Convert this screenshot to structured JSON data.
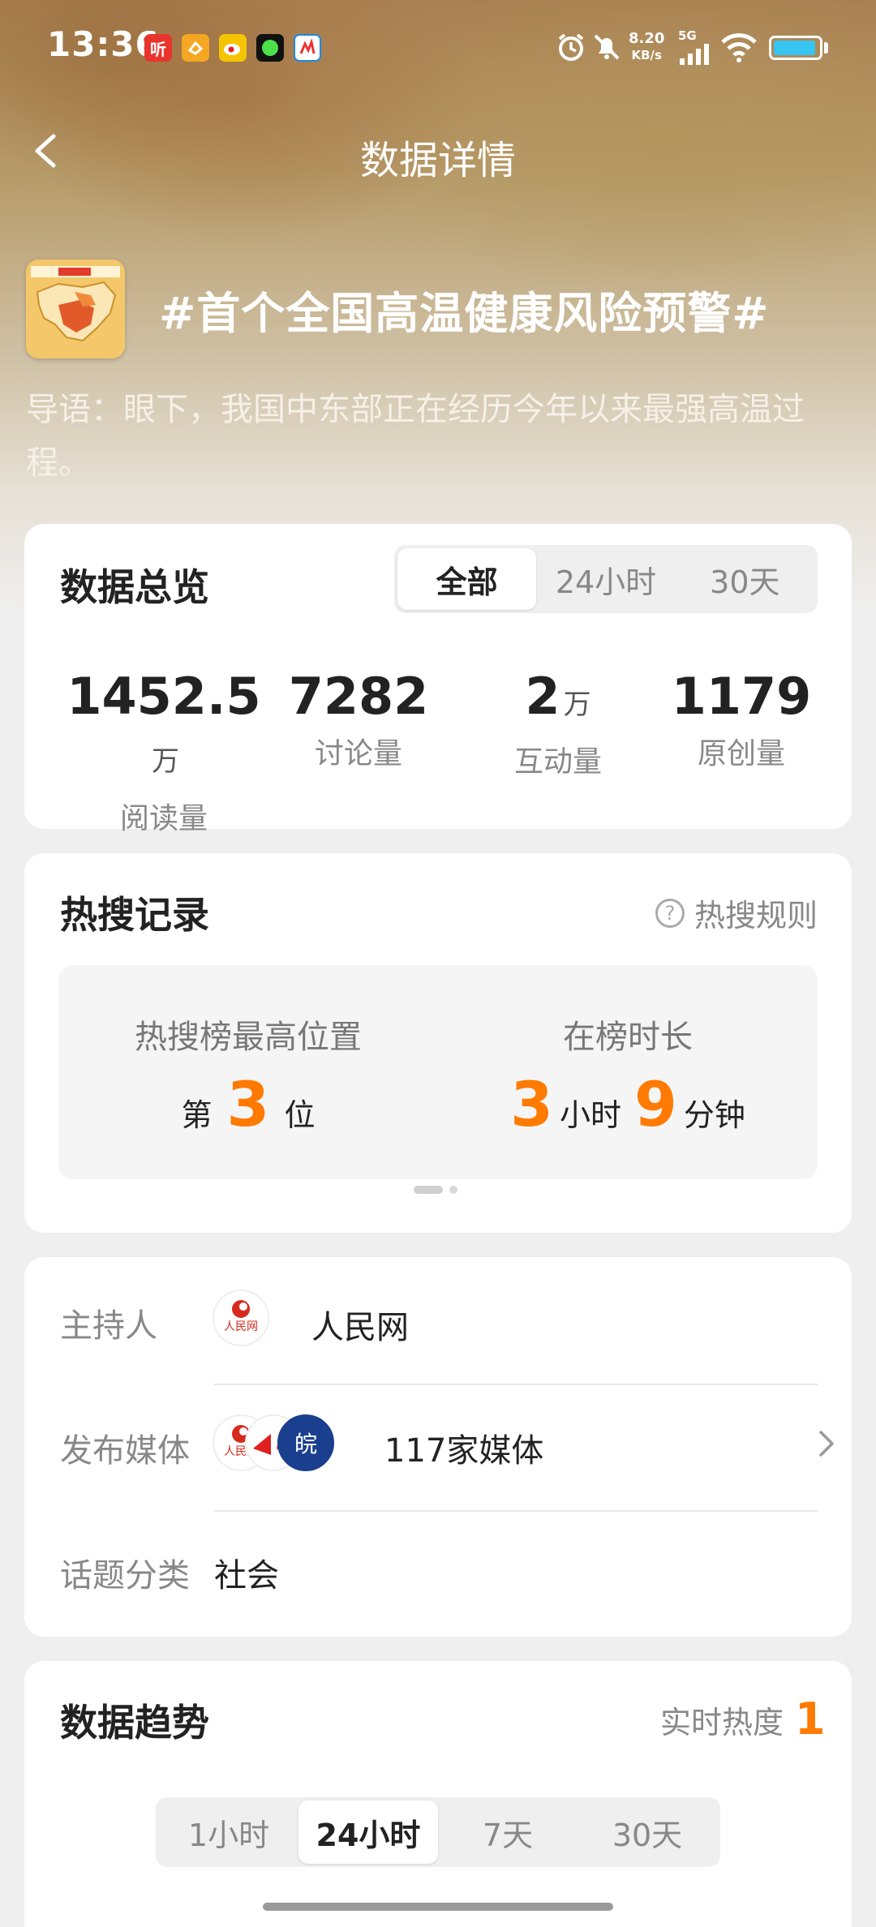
{
  "status_bar": {
    "time": "13:36",
    "apps": [
      {
        "icon": "listen-app-icon",
        "text": "听",
        "color": "#e8342d"
      },
      {
        "icon": "orange-app-icon",
        "text": "",
        "color": "#f5a623"
      },
      {
        "icon": "weibo-icon",
        "text": "",
        "color": "#f5c400"
      },
      {
        "icon": "green-dot-app-icon",
        "text": "",
        "color": "#111111"
      },
      {
        "icon": "news-app-icon",
        "text": "",
        "color": "#1e88e5"
      }
    ],
    "net_speed_value": "8.20",
    "net_speed_unit": "KB/s",
    "network": "5G",
    "battery_level": 0.95
  },
  "nav": {
    "title": "数据详情"
  },
  "topic": {
    "title": "#首个全国高温健康风险预警#",
    "intro": "导语：眼下，我国中东部正在经历今年以来最强高温过程。"
  },
  "overview": {
    "title": "数据总览",
    "tabs": [
      "全部",
      "24小时",
      "30天"
    ],
    "active_tab": 0,
    "stats": [
      {
        "value": "1452.5",
        "unit": "万",
        "label": "阅读量"
      },
      {
        "value": "7282",
        "unit": "",
        "label": "讨论量"
      },
      {
        "value": "2",
        "unit": "万",
        "label": "互动量"
      },
      {
        "value": "1179",
        "unit": "",
        "label": "原创量"
      }
    ]
  },
  "hot_search": {
    "title": "热搜记录",
    "rules_label": "热搜规则",
    "peak_label": "热搜榜最高位置",
    "peak_prefix": "第",
    "peak_value": "3",
    "peak_suffix": "位",
    "duration_label": "在榜时长",
    "duration_hours": "3",
    "hours_unit": "小时",
    "duration_minutes": "9",
    "minutes_unit": "分钟"
  },
  "info": {
    "host_label": "主持人",
    "host_name": "人民网",
    "media_label": "发布媒体",
    "media_count": "117家媒体",
    "category_label": "话题分类",
    "category_value": "社会"
  },
  "trend": {
    "title": "数据趋势",
    "realtime_label": "实时热度",
    "realtime_value": "1",
    "tabs": [
      "1小时",
      "24小时",
      "7天",
      "30天"
    ],
    "active_tab": 1
  },
  "colors": {
    "accent": "#ff7a00",
    "card": "#ffffff",
    "background": "#efefef"
  }
}
